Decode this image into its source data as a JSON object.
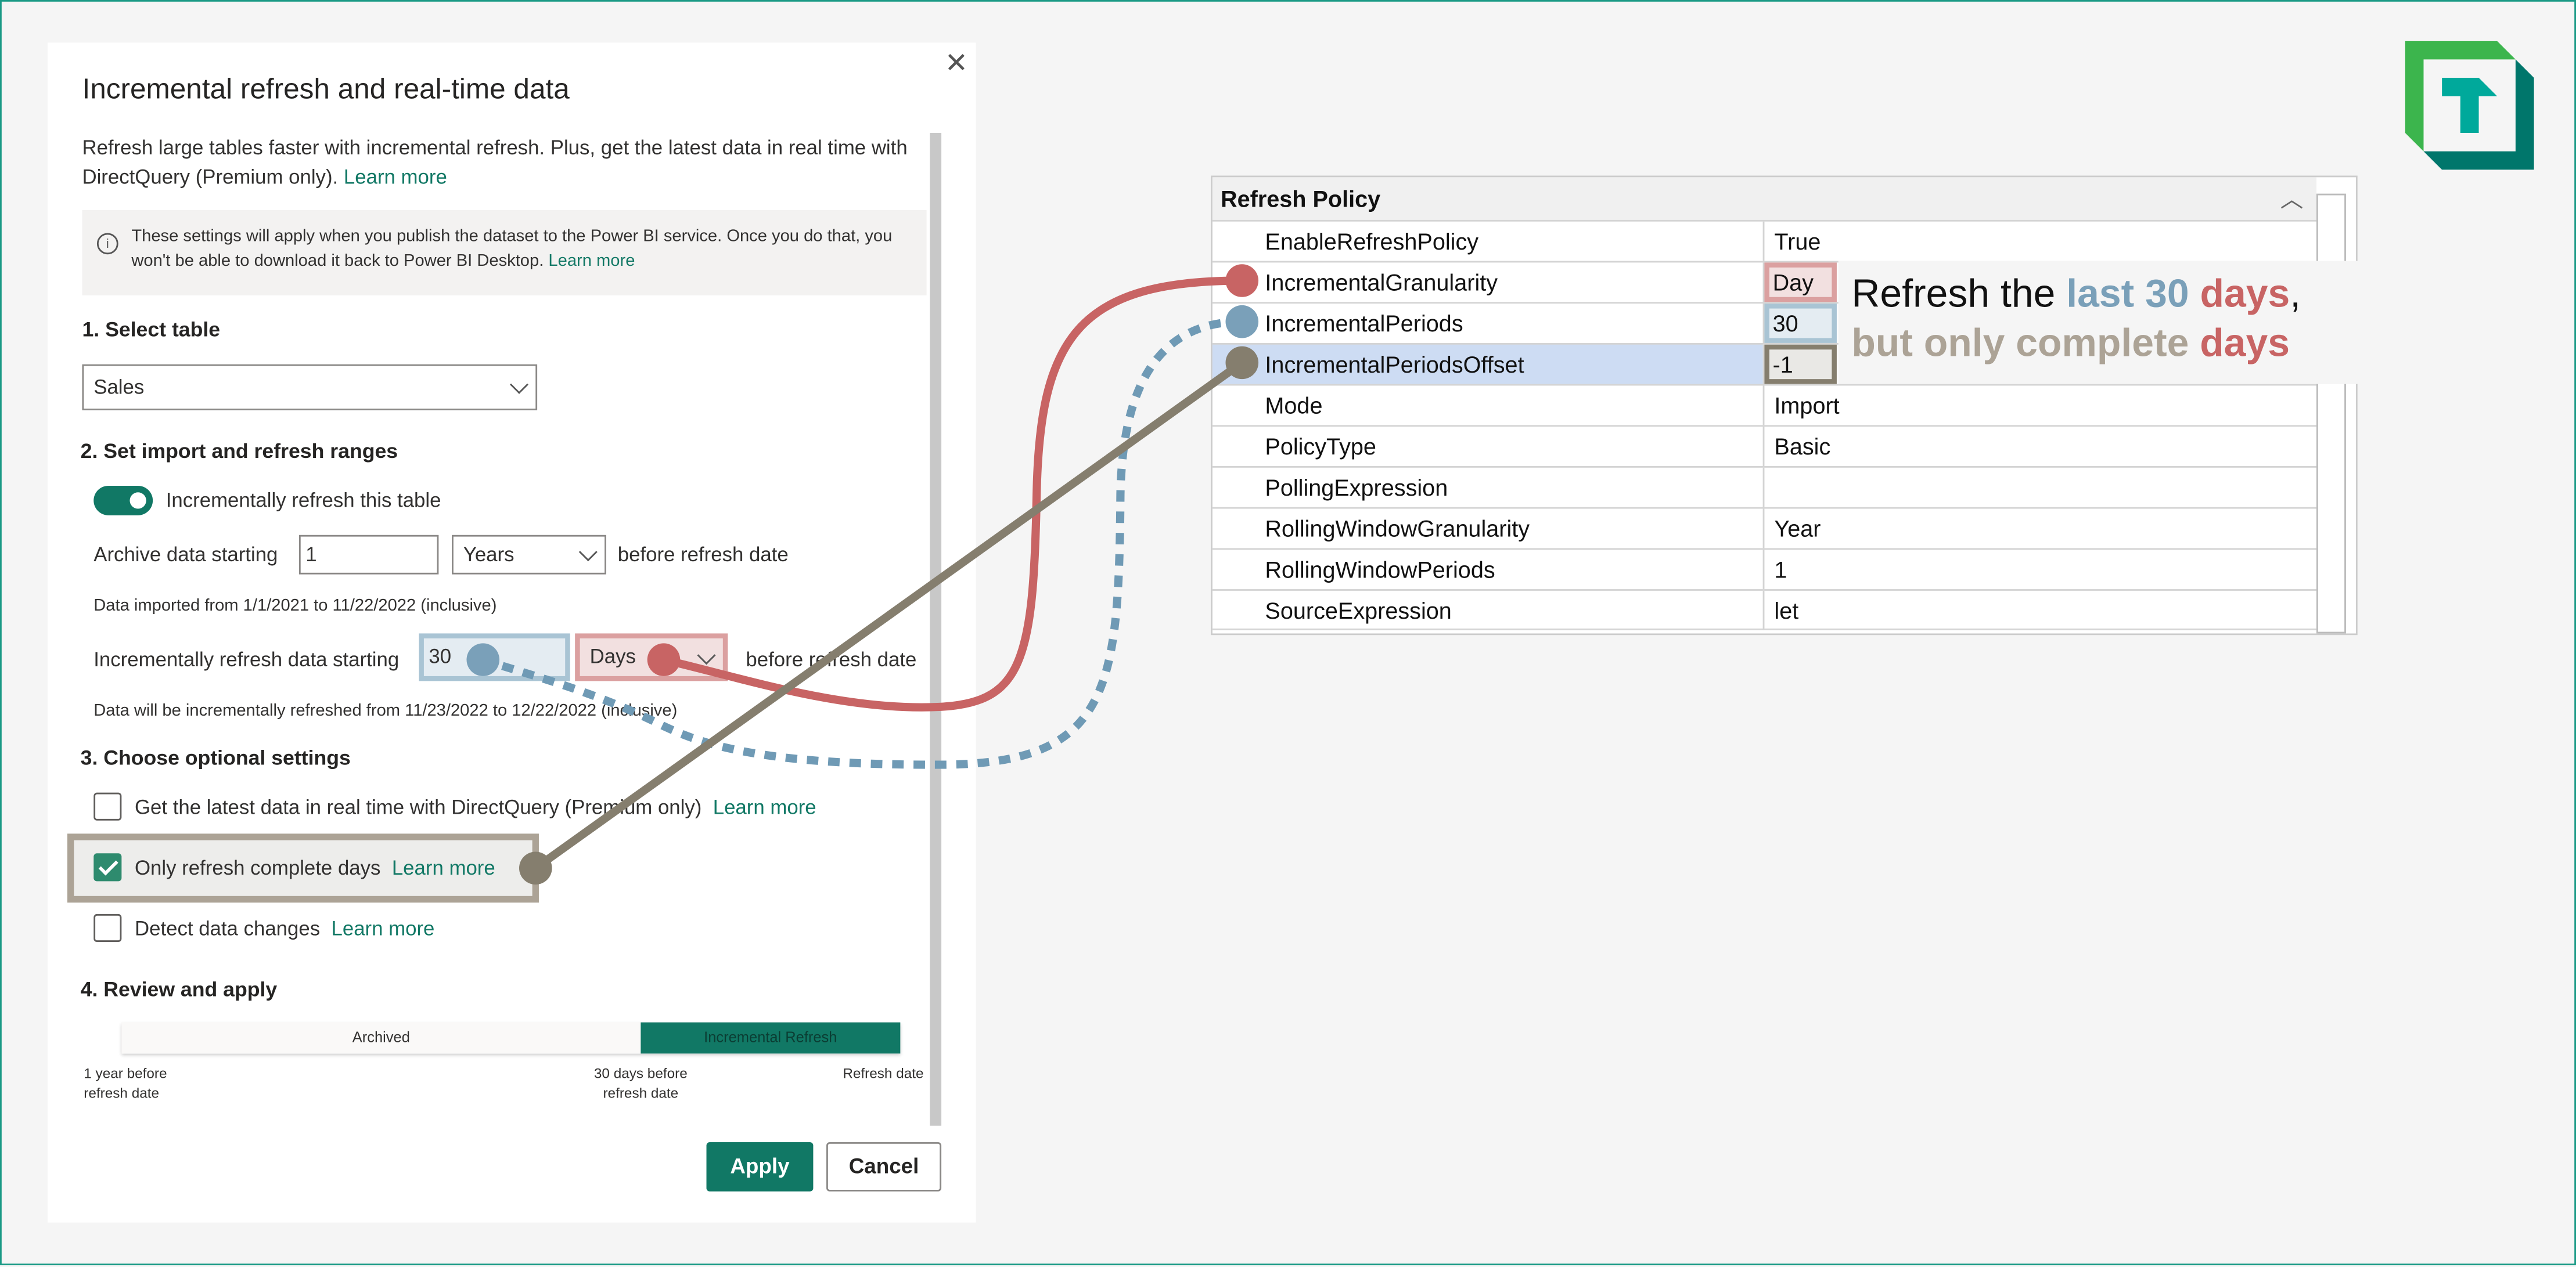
{
  "dialog": {
    "title": "Incremental refresh and real-time data",
    "close_icon": "close-icon",
    "description": "Refresh large tables faster with incremental refresh. Plus, get the latest data in real time with DirectQuery (Premium only).",
    "description_link": "Learn more",
    "info_text": "These settings will apply when you publish the dataset to the Power BI service. Once you do that, you won't be able to download it back to Power BI Desktop.",
    "info_link": "Learn more",
    "section1": {
      "title": "1. Select table",
      "table_value": "Sales"
    },
    "section2": {
      "title": "2. Set import and refresh ranges",
      "toggle_label": "Incrementally refresh this table",
      "toggle_on": true,
      "archive_label": "Archive data starting",
      "archive_value": "1",
      "archive_unit": "Years",
      "archive_suffix": "before refresh date",
      "archive_note": "Data imported from 1/1/2021 to 11/22/2022 (inclusive)",
      "incremental_label": "Incrementally refresh data starting",
      "incremental_value": "30",
      "incremental_unit": "Days",
      "incremental_suffix": "before refresh date",
      "incremental_note": "Data will be incrementally refreshed from 11/23/2022 to 12/22/2022 (inclusive)"
    },
    "section3": {
      "title": "3. Choose optional settings",
      "options": [
        {
          "label": "Get the latest data in real time with DirectQuery (Premium only)",
          "link": "Learn more",
          "checked": false
        },
        {
          "label": "Only refresh complete days",
          "link": "Learn more",
          "checked": true
        },
        {
          "label": "Detect data changes",
          "link": "Learn more",
          "checked": false
        }
      ]
    },
    "section4": {
      "title": "4. Review and apply",
      "bar_archived": "Archived",
      "bar_incremental": "Incremental Refresh",
      "tick_start": "1 year before refresh date",
      "tick_mid": "30 days before refresh date",
      "tick_end": "Refresh date"
    },
    "apply_label": "Apply",
    "cancel_label": "Cancel"
  },
  "property_grid": {
    "header": "Refresh Policy",
    "rows": [
      {
        "name": "EnableRefreshPolicy",
        "value": "True"
      },
      {
        "name": "IncrementalGranularity",
        "value": "Day"
      },
      {
        "name": "IncrementalPeriods",
        "value": "30"
      },
      {
        "name": "IncrementalPeriodsOffset",
        "value": "-1"
      },
      {
        "name": "Mode",
        "value": "Import"
      },
      {
        "name": "PolicyType",
        "value": "Basic"
      },
      {
        "name": "PollingExpression",
        "value": ""
      },
      {
        "name": "RollingWindowGranularity",
        "value": "Year"
      },
      {
        "name": "RollingWindowPeriods",
        "value": "1"
      },
      {
        "name": "SourceExpression",
        "value": "let"
      }
    ]
  },
  "callout": {
    "p1": "Refresh the ",
    "p2": "last 30 ",
    "p3": "days",
    "p4": ",",
    "p5": "but only complete ",
    "p6": "days"
  },
  "colors": {
    "accent": "#117865",
    "granularity": "#c86464",
    "periods": "#7aa0b9",
    "offset": "#857e6e",
    "complete": "#aca396"
  },
  "logo": {
    "letter": "T"
  }
}
